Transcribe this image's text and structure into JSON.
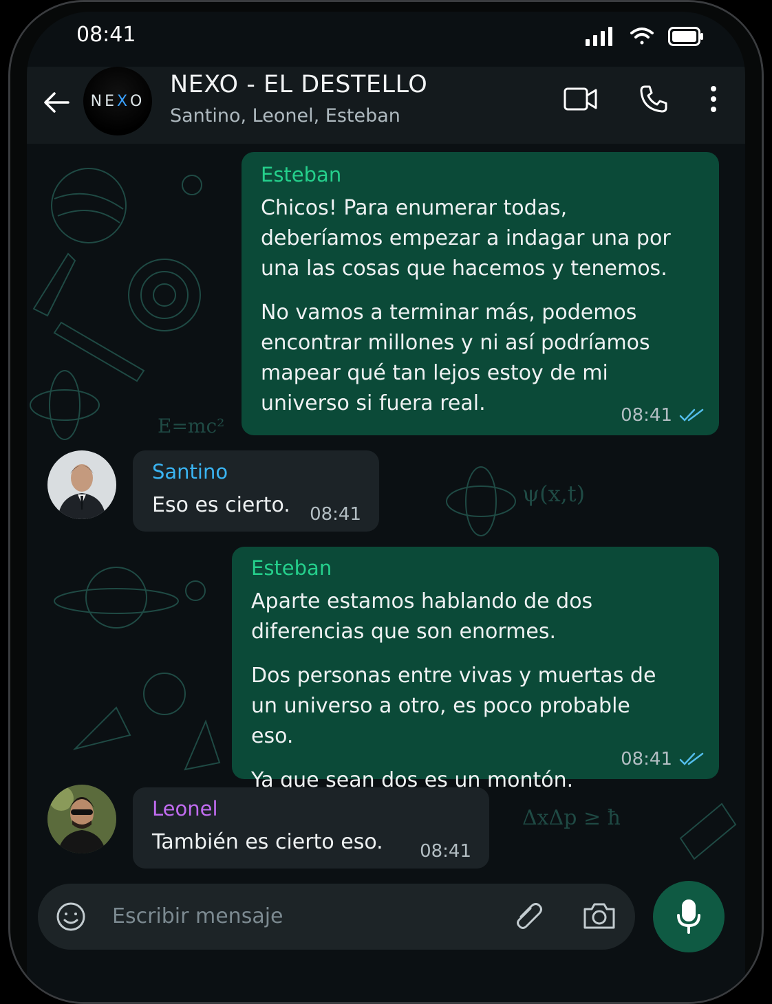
{
  "status": {
    "time": "08:41"
  },
  "header": {
    "title": "NEXO - EL DESTELLO",
    "subtitle": "Santino, Leonel, Esteban",
    "logo": {
      "left": "NE",
      "mark": "X",
      "right": "O"
    }
  },
  "messages": [
    {
      "direction": "outgoing",
      "sender": "Esteban",
      "paragraphs": [
        "Chicos! Para enumerar todas, deberíamos empezar a indagar una por una las cosas que hacemos y tenemos.",
        "No vamos a terminar más, podemos encontrar millones y ni así podríamos mapear qué tan lejos estoy de mi universo si fuera real."
      ],
      "time": "08:41",
      "read": true
    },
    {
      "direction": "incoming",
      "sender": "Santino",
      "paragraphs": [
        "Eso es cierto."
      ],
      "time": "08:41"
    },
    {
      "direction": "outgoing",
      "sender": "Esteban",
      "paragraphs": [
        "Aparte estamos hablando de dos diferencias que son enormes.",
        "Dos personas entre vivas y muertas de un universo a otro, es poco probable eso.",
        "Ya que sean dos es un montón."
      ],
      "time": "08:41",
      "read": true
    },
    {
      "direction": "incoming",
      "sender": "Leonel",
      "paragraphs": [
        "También es cierto eso."
      ],
      "time": "08:41"
    }
  ],
  "colors": {
    "esteban": "#25d08c",
    "santino": "#3ab4f2",
    "leonel": "#c16cf0",
    "outgoing_bubble": "#0b4a38",
    "incoming_bubble": "#1c2327",
    "read_ticks": "#53bdeb"
  },
  "input": {
    "placeholder": "Escribir mensaje"
  },
  "icons": [
    "back-arrow-icon",
    "video-call-icon",
    "phone-icon",
    "more-options-icon",
    "emoji-icon",
    "attach-icon",
    "camera-icon",
    "mic-icon",
    "signal-icon",
    "wifi-icon",
    "battery-icon"
  ]
}
